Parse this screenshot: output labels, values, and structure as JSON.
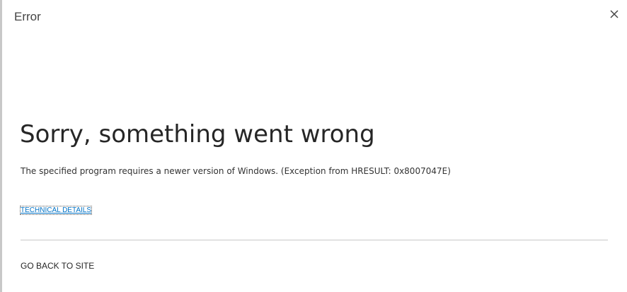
{
  "dialog": {
    "title": "Error",
    "close_icon": "close-icon"
  },
  "main": {
    "heading": "Sorry, something went wrong",
    "message": "The specified program requires a newer version of Windows. (Exception from HRESULT: 0x8007047E)",
    "technical_details_label": "TECHNICAL DETAILS",
    "back_label": "GO BACK TO SITE"
  },
  "colors": {
    "link": "#0072c6",
    "text": "#262626",
    "divider": "#c8c8c8"
  }
}
